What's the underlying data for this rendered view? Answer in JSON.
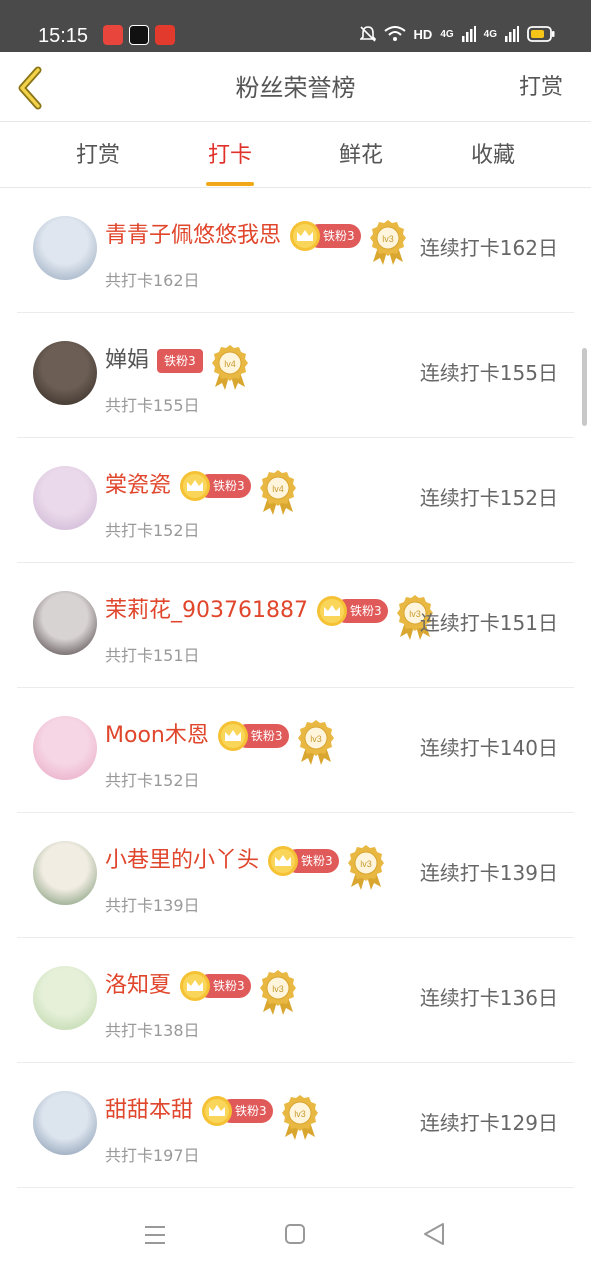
{
  "status_bar": {
    "time": "15:15",
    "network_label": "HD",
    "signal_label_1": "4G",
    "signal_label_2": "4G",
    "icons": [
      "mute-bell-icon",
      "wifi-icon",
      "signal-icon",
      "battery-icon"
    ]
  },
  "header": {
    "title": "粉丝荣誉榜",
    "right_action": "打赏",
    "back_icon": "chevron-left-icon"
  },
  "tabs": [
    {
      "label": "打赏",
      "active": false
    },
    {
      "label": "打卡",
      "active": true
    },
    {
      "label": "鲜花",
      "active": false
    },
    {
      "label": "收藏",
      "active": false
    }
  ],
  "colors": {
    "accent": "#f0a818",
    "name_red": "#e0462c",
    "badge_red": "#e15a5a",
    "status_bar": "#4a4a4a"
  },
  "fans": [
    {
      "name": "青青子佩悠悠我思",
      "badge": "铁粉3",
      "level": "lv3",
      "crown": true,
      "name_plain": false,
      "total": "共打卡162日",
      "streak": "连续打卡162日"
    },
    {
      "name": "婵娟",
      "badge": "铁粉3",
      "level": "lv4",
      "crown": false,
      "name_plain": true,
      "total": "共打卡155日",
      "streak": "连续打卡155日"
    },
    {
      "name": "棠瓷瓷",
      "badge": "铁粉3",
      "level": "lv4",
      "crown": true,
      "name_plain": false,
      "total": "共打卡152日",
      "streak": "连续打卡152日"
    },
    {
      "name": "茉莉花_903761887",
      "badge": "铁粉3",
      "level": "lv3",
      "crown": true,
      "name_plain": false,
      "total": "共打卡151日",
      "streak": "连续打卡151日"
    },
    {
      "name": "Moon木恩",
      "badge": "铁粉3",
      "level": "lv3",
      "crown": true,
      "name_plain": false,
      "total": "共打卡152日",
      "streak": "连续打卡140日"
    },
    {
      "name": "小巷里的小丫头",
      "badge": "铁粉3",
      "level": "lv3",
      "crown": true,
      "name_plain": false,
      "total": "共打卡139日",
      "streak": "连续打卡139日"
    },
    {
      "name": "洛知夏",
      "badge": "铁粉3",
      "level": "lv3",
      "crown": true,
      "name_plain": false,
      "total": "共打卡138日",
      "streak": "连续打卡136日"
    },
    {
      "name": "甜甜本甜",
      "badge": "铁粉3",
      "level": "lv3",
      "crown": true,
      "name_plain": false,
      "total": "共打卡197日",
      "streak": "连续打卡129日"
    }
  ],
  "nav": {
    "icons": [
      "menu-icon",
      "home-square-icon",
      "back-triangle-icon"
    ]
  }
}
